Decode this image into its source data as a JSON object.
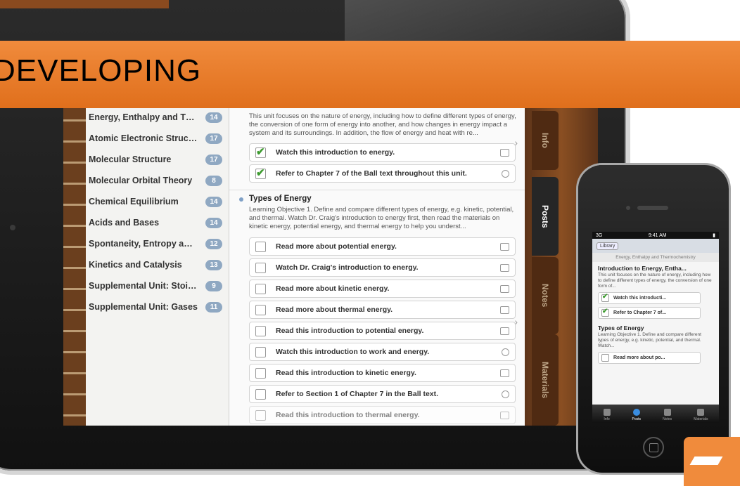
{
  "banner": {
    "text": "DEVELOPING"
  },
  "ipad": {
    "units": [
      {
        "label": "Energy, Enthalpy and Ther...",
        "count": "14"
      },
      {
        "label": "Atomic Electronic Structure",
        "count": "17"
      },
      {
        "label": "Molecular Structure",
        "count": "17"
      },
      {
        "label": "Molecular Orbital Theory",
        "count": "8"
      },
      {
        "label": "Chemical Equilibrium",
        "count": "14"
      },
      {
        "label": "Acids and Bases",
        "count": "14"
      },
      {
        "label": "Spontaneity, Entropy and...",
        "count": "12"
      },
      {
        "label": "Kinetics and Catalysis",
        "count": "13"
      },
      {
        "label": "Supplemental Unit: Stoichi...",
        "count": "9"
      },
      {
        "label": "Supplemental Unit: Gases",
        "count": "11"
      }
    ],
    "intro_text": "This unit focuses on the nature of energy, including how to define different types of energy, the conversion of one form of energy into another, and how changes in energy impact a system and its surroundings. In addition, the flow of energy and heat with re...",
    "intro_tasks": [
      {
        "label": "Watch this introduction to energy.",
        "checked": true
      },
      {
        "label": "Refer to Chapter 7 of the Ball text throughout this unit.",
        "checked": true
      }
    ],
    "section": {
      "title": "Types of Energy",
      "desc": "Learning Objective 1. Define and compare different types of energy, e.g. kinetic, potential, and thermal. Watch Dr. Craig's introduction to energy first, then read the materials on kinetic energy, potential energy, and thermal energy to help you underst..."
    },
    "tasks": [
      {
        "label": "Read more about potential energy."
      },
      {
        "label": "Watch Dr. Craig's introduction to energy."
      },
      {
        "label": "Read more about kinetic energy."
      },
      {
        "label": "Read more about thermal energy."
      },
      {
        "label": "Read this introduction to potential energy."
      },
      {
        "label": "Watch this introduction to work and energy."
      },
      {
        "label": "Read this introduction to kinetic energy."
      },
      {
        "label": "Refer to Section 1 of Chapter 7 in the Ball text."
      },
      {
        "label": "Read this introduction to thermal energy."
      }
    ],
    "tabs": [
      "Info",
      "Posts",
      "Notes",
      "Materials"
    ]
  },
  "iphone": {
    "status_left": "3G",
    "status_time": "9:41 AM",
    "back_button": "Library",
    "subtitle": "Energy, Enthalpy and Thermochemistry",
    "title": "Introduction to Energy, Entha...",
    "text": "This unit focuses on the nature of energy, including how to define different types of energy, the conversion of one form of...",
    "tasks": [
      "Watch this introducti...",
      "Refer to Chapter 7 of..."
    ],
    "section_title": "Types of Energy",
    "section_text": "Learning Objective 1. Define and compare different types of energy, e.g. kinetic, potential, and thermal. Watch...",
    "section_task": "Read more about po...",
    "tabbar": [
      "Info",
      "Posts",
      "Notes",
      "Materials"
    ]
  }
}
